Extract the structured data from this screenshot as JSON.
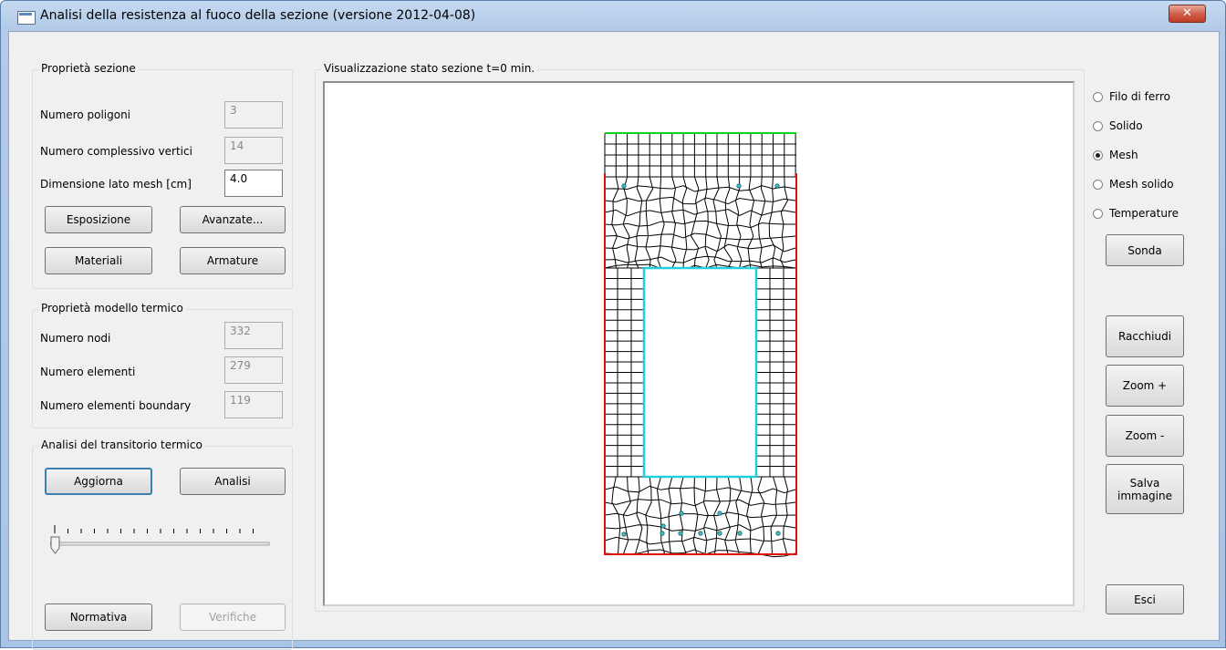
{
  "window": {
    "title": "Analisi della resistenza al fuoco della sezione (versione 2012-04-08)",
    "close_label": "x"
  },
  "section_props": {
    "legend": "Proprietà sezione",
    "num_polygons_label": "Numero poligoni",
    "num_polygons": "3",
    "num_vertices_label": "Numero complessivo vertici",
    "num_vertices": "14",
    "mesh_size_label": "Dimensione lato mesh [cm]",
    "mesh_size": "4.0",
    "exposure_btn": "Esposizione",
    "advanced_btn": "Avanzate...",
    "materials_btn": "Materiali",
    "reinforcement_btn": "Armature"
  },
  "thermal_model": {
    "legend": "Proprietà modello termico",
    "nodes_label": "Numero nodi",
    "nodes": "332",
    "elements_label": "Numero elementi",
    "elements": "279",
    "boundary_label": "Numero elementi boundary",
    "boundary": "119"
  },
  "transient": {
    "legend": "Analisi del transitorio termico",
    "update_btn": "Aggiorna",
    "analysis_btn": "Analisi",
    "slider_value": 0,
    "norm_btn": "Normativa",
    "checks_btn": "Verifiche"
  },
  "view": {
    "legend": "Visualizzazione stato sezione t=0 min."
  },
  "display_modes": {
    "options": [
      "Filo di ferro",
      "Solido",
      "Mesh",
      "Mesh solido",
      "Temperature"
    ],
    "selected": "Mesh"
  },
  "right_buttons": {
    "probe": "Sonda",
    "enclose": "Racchiudi",
    "zoom_in": "Zoom +",
    "zoom_out": "Zoom -",
    "save_image": "Salva immagine",
    "exit": "Esci"
  },
  "colors": {
    "exposed_edge": "#e01010",
    "top_edge": "#10d020",
    "hole_edge": "#20d0e0",
    "mesh": "#000000",
    "rebar": "#40c0c0"
  }
}
